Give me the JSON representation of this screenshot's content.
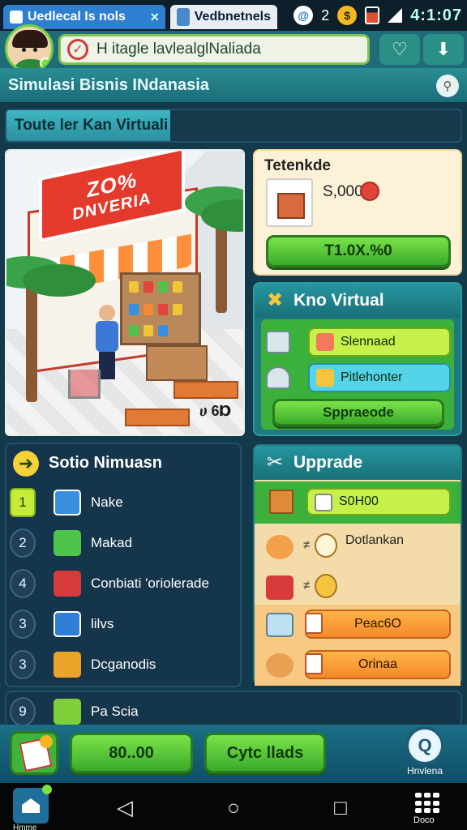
{
  "status_bar": {
    "tab1_title": "Uedlecal Is nols",
    "tab1_close": "×",
    "tab2_title": "Vedbnetnels",
    "badge_count": "2",
    "clock": "4:1:07"
  },
  "header": {
    "search_text": "H itagle lavlealglNaliada"
  },
  "titlebar": {
    "title": "Simulasi Bisnis INdanasia"
  },
  "section": {
    "label": "Toute ler Kan Virtuali"
  },
  "scene": {
    "sign_line1": "ZO%",
    "sign_line2": "DNVERIA",
    "price": "ሀ 6Ɒ"
  },
  "trade_panel": {
    "title": "Tetenkde",
    "amount": "S,000",
    "button": "T1.0X.%0"
  },
  "kno_panel": {
    "title": "Kno Virtual",
    "pill1": "Slennaad",
    "pill2": "Pitlehonter",
    "button": "Sppraeode"
  },
  "list_panel": {
    "title": "Sotio Nimuasn",
    "items": [
      {
        "num": "1",
        "label": "Nake",
        "icon_color": "#3a8ee0"
      },
      {
        "num": "2",
        "label": "Makad",
        "icon_color": "#4ec44a"
      },
      {
        "num": "4",
        "label": "Conbiati 'oriolerade",
        "icon_color": "#d83a3a"
      },
      {
        "num": "3",
        "label": "lilvs",
        "icon_color": "#2f7fd6"
      },
      {
        "num": "3",
        "label": "Dcganodis",
        "icon_color": "#e9a52a"
      },
      {
        "num": "9",
        "label": "Pa Scia",
        "icon_color": "#7fcf3a"
      }
    ]
  },
  "upgrade_panel": {
    "title": "Upprade",
    "top_pill": "S0H00",
    "row1_text": "Dotlankan",
    "row3_pill": "Peac6O",
    "row4_pill": "Orinaa"
  },
  "action_bar": {
    "btn1": "80..00",
    "btn2": "Cytc llads",
    "help_label": "Hnvlena"
  },
  "nav_bar": {
    "home_label": "Hmme",
    "grid_label": "Doco"
  }
}
